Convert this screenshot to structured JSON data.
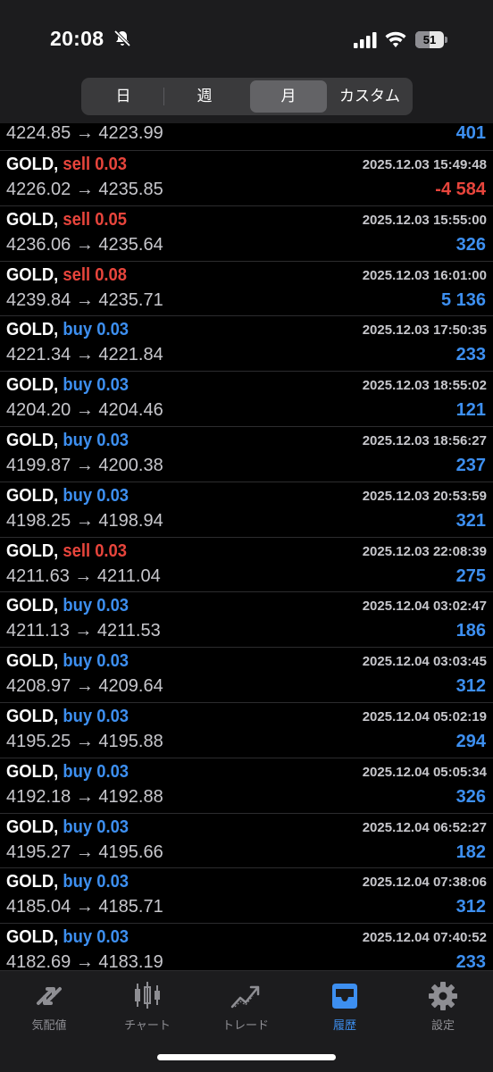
{
  "status_bar": {
    "time": "20:08",
    "battery": "51",
    "battery_level": 0.51
  },
  "segment": {
    "items": [
      "日",
      "週",
      "月",
      "カスタム"
    ],
    "selected": "月"
  },
  "partial_row": {
    "prices": "4224.85 → 4223.99",
    "profit": "401"
  },
  "trades": [
    {
      "symbol": "GOLD,",
      "side": "sell",
      "volume": "sell 0.03",
      "time": "2025.12.03 15:49:48",
      "prices": "4226.02 → 4235.85",
      "profit": "-4 584"
    },
    {
      "symbol": "GOLD,",
      "side": "sell",
      "volume": "sell 0.05",
      "time": "2025.12.03 15:55:00",
      "prices": "4236.06 → 4235.64",
      "profit": "326"
    },
    {
      "symbol": "GOLD,",
      "side": "sell",
      "volume": "sell 0.08",
      "time": "2025.12.03 16:01:00",
      "prices": "4239.84 → 4235.71",
      "profit": "5 136"
    },
    {
      "symbol": "GOLD,",
      "side": "buy",
      "volume": "buy 0.03",
      "time": "2025.12.03 17:50:35",
      "prices": "4221.34 → 4221.84",
      "profit": "233"
    },
    {
      "symbol": "GOLD,",
      "side": "buy",
      "volume": "buy 0.03",
      "time": "2025.12.03 18:55:02",
      "prices": "4204.20 → 4204.46",
      "profit": "121"
    },
    {
      "symbol": "GOLD,",
      "side": "buy",
      "volume": "buy 0.03",
      "time": "2025.12.03 18:56:27",
      "prices": "4199.87 → 4200.38",
      "profit": "237"
    },
    {
      "symbol": "GOLD,",
      "side": "buy",
      "volume": "buy 0.03",
      "time": "2025.12.03 20:53:59",
      "prices": "4198.25 → 4198.94",
      "profit": "321"
    },
    {
      "symbol": "GOLD,",
      "side": "sell",
      "volume": "sell 0.03",
      "time": "2025.12.03 22:08:39",
      "prices": "4211.63 → 4211.04",
      "profit": "275"
    },
    {
      "symbol": "GOLD,",
      "side": "buy",
      "volume": "buy 0.03",
      "time": "2025.12.04 03:02:47",
      "prices": "4211.13 → 4211.53",
      "profit": "186"
    },
    {
      "symbol": "GOLD,",
      "side": "buy",
      "volume": "buy 0.03",
      "time": "2025.12.04 03:03:45",
      "prices": "4208.97 → 4209.64",
      "profit": "312"
    },
    {
      "symbol": "GOLD,",
      "side": "buy",
      "volume": "buy 0.03",
      "time": "2025.12.04 05:02:19",
      "prices": "4195.25 → 4195.88",
      "profit": "294"
    },
    {
      "symbol": "GOLD,",
      "side": "buy",
      "volume": "buy 0.03",
      "time": "2025.12.04 05:05:34",
      "prices": "4192.18 → 4192.88",
      "profit": "326"
    },
    {
      "symbol": "GOLD,",
      "side": "buy",
      "volume": "buy 0.03",
      "time": "2025.12.04 06:52:27",
      "prices": "4195.27 → 4195.66",
      "profit": "182"
    },
    {
      "symbol": "GOLD,",
      "side": "buy",
      "volume": "buy 0.03",
      "time": "2025.12.04 07:38:06",
      "prices": "4185.04 → 4185.71",
      "profit": "312"
    },
    {
      "symbol": "GOLD,",
      "side": "buy",
      "volume": "buy 0.03",
      "time": "2025.12.04 07:40:52",
      "prices": "4182.69 → 4183.19",
      "profit": "233"
    }
  ],
  "tabs": [
    {
      "label": "気配値",
      "icon": "quotes-icon",
      "active": false
    },
    {
      "label": "チャート",
      "icon": "chart-icon",
      "active": false
    },
    {
      "label": "トレード",
      "icon": "trade-icon",
      "active": false
    },
    {
      "label": "履歴",
      "icon": "history-icon",
      "active": true
    },
    {
      "label": "設定",
      "icon": "settings-icon",
      "active": false
    }
  ],
  "colors": {
    "sell": "#e8453c",
    "buy": "#3d8ff0",
    "active_tab": "#3d8ff0"
  }
}
